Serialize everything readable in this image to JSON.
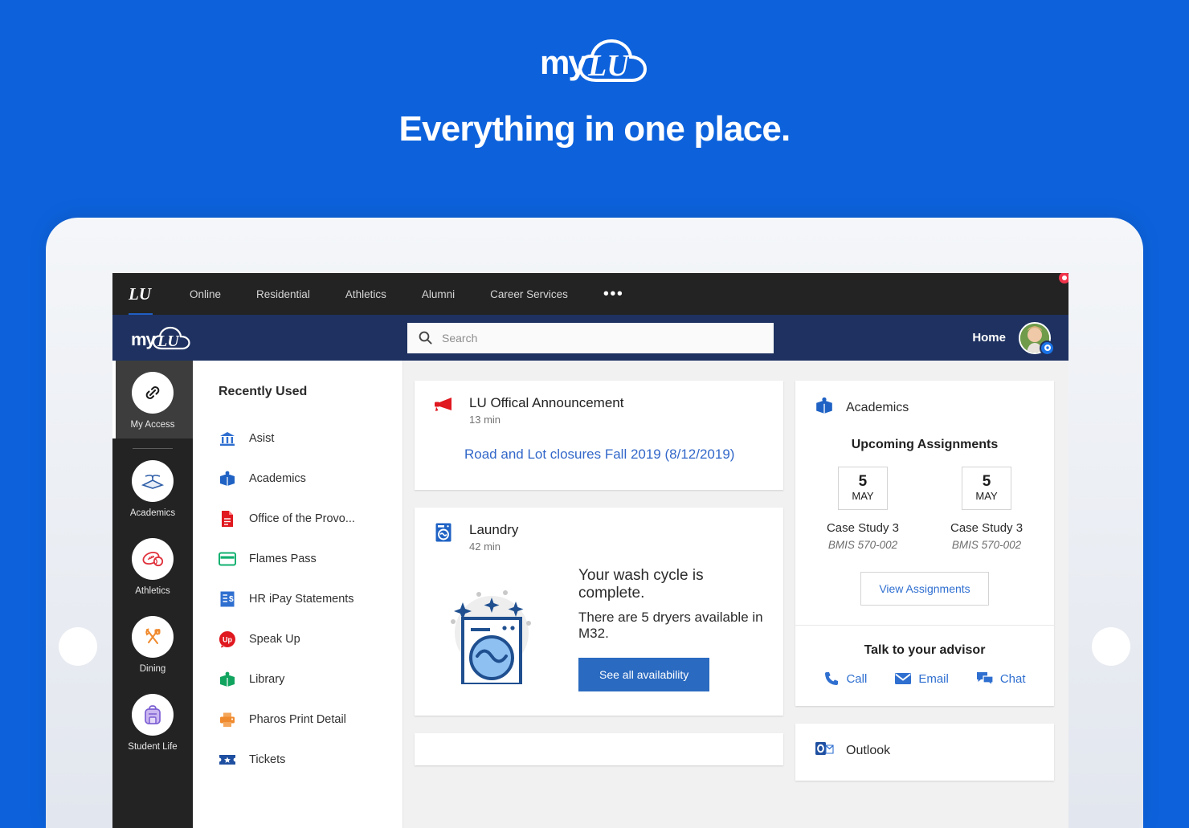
{
  "hero": {
    "logo_alt": "myLU",
    "tagline": "Everything in one place."
  },
  "colors": {
    "page_background": "#0d62dc",
    "topnav_background": "#232323",
    "header_background": "#1e3160",
    "accent_blue": "#2a6ac0",
    "link_blue": "#3267c9",
    "badge_red": "#f0344a"
  },
  "topnav": {
    "brand": "LU",
    "links": [
      {
        "label": "Online"
      },
      {
        "label": "Residential"
      },
      {
        "label": "Athletics"
      },
      {
        "label": "Alumni"
      },
      {
        "label": "Career Services"
      }
    ],
    "overflow": "•••"
  },
  "header": {
    "logo_alt": "myLU",
    "search": {
      "placeholder": "Search",
      "value": "",
      "icon": "search-icon"
    },
    "home_label": "Home",
    "avatar_icon": "avatar",
    "settings_icon": "gear-icon"
  },
  "sidebar": {
    "items": [
      {
        "label": "My Access",
        "icon": "link-icon",
        "active": true,
        "badge": false
      },
      {
        "label": "Academics",
        "icon": "book-icon",
        "active": false,
        "badge": true
      },
      {
        "label": "Athletics",
        "icon": "football-icon",
        "active": false,
        "badge": false
      },
      {
        "label": "Dining",
        "icon": "utensils-icon",
        "active": false,
        "badge": false
      },
      {
        "label": "Student Life",
        "icon": "backpack-icon",
        "active": false,
        "badge": false
      }
    ]
  },
  "recently_used": {
    "title": "Recently Used",
    "items": [
      {
        "label": "Asist",
        "icon": "bank-icon"
      },
      {
        "label": "Academics",
        "icon": "book-icon"
      },
      {
        "label": "Office of the Provo...",
        "icon": "document-icon"
      },
      {
        "label": "Flames Pass",
        "icon": "card-icon"
      },
      {
        "label": "HR iPay Statements",
        "icon": "receipt-icon"
      },
      {
        "label": "Speak Up",
        "icon": "speakup-icon"
      },
      {
        "label": "Library",
        "icon": "library-icon"
      },
      {
        "label": "Pharos Print Detail",
        "icon": "printer-icon"
      },
      {
        "label": "Tickets",
        "icon": "ticket-icon"
      }
    ]
  },
  "announcement_card": {
    "icon": "megaphone-icon",
    "title": "LU Offical Announcement",
    "time": "13 min",
    "link": "Road and Lot closures Fall 2019 (8/12/2019)"
  },
  "laundry_card": {
    "icon": "washer-icon",
    "title": "Laundry",
    "time": "42 min",
    "art_icon": "washing-machine-illustration",
    "line1": "Your wash cycle is complete.",
    "line2": "There are 5 dryers available in M32.",
    "button": "See all availability"
  },
  "academics_card": {
    "icon": "book-icon",
    "title": "Academics",
    "section_title": "Upcoming Assignments",
    "assignments": [
      {
        "day": "5",
        "month": "MAY",
        "name": "Case Study 3",
        "course": "BMIS 570-002"
      },
      {
        "day": "5",
        "month": "MAY",
        "name": "Case Study 3",
        "course": "BMIS 570-002"
      }
    ],
    "view_button": "View Assignments",
    "advisor_title": "Talk to your advisor",
    "advisor_actions": [
      {
        "label": "Call",
        "icon": "phone-icon"
      },
      {
        "label": "Email",
        "icon": "envelope-icon"
      },
      {
        "label": "Chat",
        "icon": "chat-icon"
      }
    ]
  },
  "outlook_card": {
    "icon": "outlook-icon",
    "title": "Outlook"
  }
}
